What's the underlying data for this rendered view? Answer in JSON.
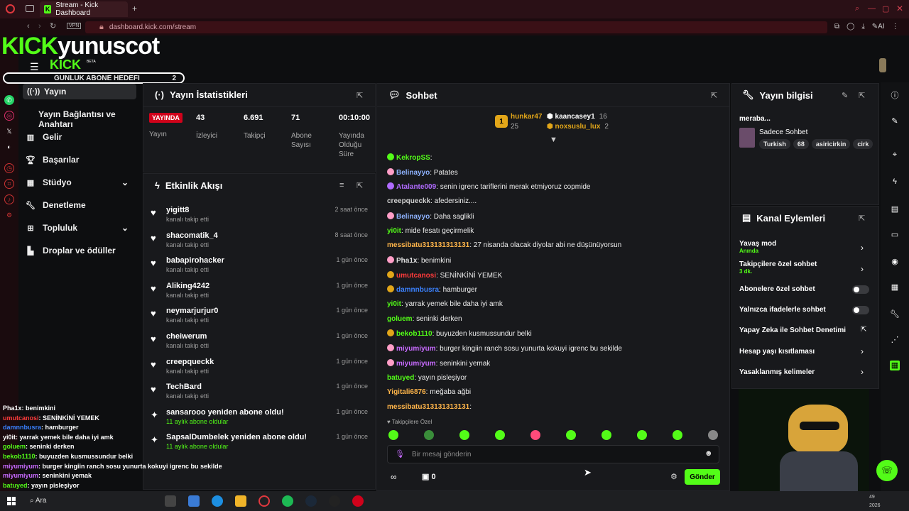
{
  "browser": {
    "tab_title": "Stream - Kick Dashboard",
    "url": "dashboard.kick.com/stream",
    "vpn": "VPN",
    "ai": "AI"
  },
  "overlay": {
    "logo_kick": "KICK",
    "channel": "yunuscot",
    "logo_sub": "KICK",
    "beta": "BETA",
    "sub_goal_label": "GUNLUK ABONE HEDEFI",
    "sub_goal_value": "2",
    "chat": [
      {
        "name": "Pha1x",
        "text": ": benimkini",
        "color": "#ffffff"
      },
      {
        "name": "umutcanosi",
        "text": ": SENİNKİNİ YEMEK",
        "color": "#ff3b3b"
      },
      {
        "name": "damnnbusra",
        "text": ": hamburger",
        "color": "#3b82ff"
      },
      {
        "name": "yi0it",
        "text": ": yarrak yemek bile daha iyi amk",
        "color": "#ffffff"
      },
      {
        "name": "goluem",
        "text": ": seninki derken",
        "color": "#53fc18"
      },
      {
        "name": "bekob1110",
        "text": ": buyuzden kusmussundur belki",
        "color": "#53fc18"
      },
      {
        "name": "miyumiyum",
        "text": ": burger kingiin ranch sosu yunurta kokuyi igrenc bu sekilde",
        "color": "#c86bff"
      },
      {
        "name": "miyumiyum",
        "text": ": seninkini yemak",
        "color": "#c86bff"
      },
      {
        "name": "batuyed",
        "text": ": yayın pisleşiyor",
        "color": "#53fc18"
      }
    ]
  },
  "nav": {
    "items": [
      {
        "label": "Yayın"
      },
      {
        "label": "Yayın Bağlantısı ve Anahtarı"
      },
      {
        "label": "Gelir"
      },
      {
        "label": "Başarılar"
      },
      {
        "label": "Stüdyo"
      },
      {
        "label": "Denetleme"
      },
      {
        "label": "Topluluk"
      },
      {
        "label": "Droplar ve ödüller"
      }
    ]
  },
  "stats": {
    "title": "Yayın İstatistikleri",
    "live": "YAYINDA",
    "live_label": "Yayın",
    "viewers": "43",
    "viewers_label": "İzleyici",
    "followers": "6.691",
    "followers_label": "Takipçi",
    "subs": "71",
    "subs_label": "Abone Sayısı",
    "uptime": "00:10:00",
    "uptime_label": "Yayında Olduğu Süre"
  },
  "activity": {
    "title": "Etkinlik Akışı",
    "events": [
      {
        "user": "yigitt8",
        "desc": "kanalı takip etti",
        "time": "2 saat önce"
      },
      {
        "user": "shacomatik_4",
        "desc": "kanalı takip etti",
        "time": "8 saat önce"
      },
      {
        "user": "babapirohacker",
        "desc": "kanalı takip etti",
        "time": "1 gün önce"
      },
      {
        "user": "Aliking4242",
        "desc": "kanalı takip etti",
        "time": "1 gün önce"
      },
      {
        "user": "neymarjurjur0",
        "desc": "kanalı takip etti",
        "time": "1 gün önce"
      },
      {
        "user": "cheiwerum",
        "desc": "kanalı takip etti",
        "time": "1 gün önce"
      },
      {
        "user": "creepqueckk",
        "desc": "kanalı takip etti",
        "time": "1 gün önce"
      },
      {
        "user": "TechBard",
        "desc": "kanalı takip etti",
        "time": "1 gün önce"
      },
      {
        "user": "sansarooo yeniden abone oldu!",
        "desc": "11 aylık abone oldular",
        "time": "1 gün önce"
      },
      {
        "user": "SapsalDumbelek yeniden abone oldu!",
        "desc": "11 aylık abone oldular",
        "time": "1 gün önce"
      }
    ]
  },
  "chat": {
    "title": "Sohbet",
    "top_gifters": [
      {
        "name": "hunkar47",
        "count": "25"
      },
      {
        "name": "kaancasey1",
        "count": "16"
      },
      {
        "name": "noxsuslu_lux",
        "count": "2"
      }
    ],
    "rank": "1",
    "messages": [
      {
        "name": "KekropSS",
        "text": ":",
        "color": "#53fc18"
      },
      {
        "name": "Belinayyo",
        "text": ": Patates",
        "color": "#8fb3ff"
      },
      {
        "name": "Atalante009",
        "text": ": senin igrenc tariflerini merak etmiyoruz copmide",
        "color": "#b06bff"
      },
      {
        "name": "creepqueckk",
        "text": ": afedersiniz....",
        "color": "#d0d0d0"
      },
      {
        "name": "Belinayyo",
        "text": ": Daha saglikli",
        "color": "#8fb3ff"
      },
      {
        "name": "yi0it",
        "text": ": mide fesatı geçirmelik",
        "color": "#53fc18"
      },
      {
        "name": "messibatu313131313131",
        "text": ": 27 nisanda olacak diyolar abi ne düşünüyorsun",
        "color": "#ffb54a"
      },
      {
        "name": "Pha1x",
        "text": ": benimkini",
        "color": "#e0e0e0"
      },
      {
        "name": "umutcanosi",
        "text": ": SENİNKİNİ YEMEK",
        "color": "#ff3b3b"
      },
      {
        "name": "damnnbusra",
        "text": ": hamburger",
        "color": "#3b82ff"
      },
      {
        "name": "yi0it",
        "text": ": yarrak yemek bile daha iyi amk",
        "color": "#53fc18"
      },
      {
        "name": "goluem",
        "text": ": seninki derken",
        "color": "#53fc18"
      },
      {
        "name": "bekob1110",
        "text": ": buyuzden kusmussundur belki",
        "color": "#53fc18"
      },
      {
        "name": "miyumiyum",
        "text": ": burger kingiin ranch sosu yunurta kokuyi igrenc bu sekilde",
        "color": "#c86bff"
      },
      {
        "name": "miyumiyum",
        "text": ": seninkini yemak",
        "color": "#c86bff"
      },
      {
        "name": "batuyed",
        "text": ": yayın pisleşiyor",
        "color": "#53fc18"
      },
      {
        "name": "Yigitali6876",
        "text": ": meğaba ağbi",
        "color": "#ffb54a"
      },
      {
        "name": "messibatu313131313131",
        "text": ":",
        "color": "#ffb54a"
      }
    ],
    "follower_mode": "Takipçilere Özel",
    "input_placeholder": "Bir mesaj gönderin",
    "points": "0",
    "send": "Gönder"
  },
  "info": {
    "title": "Yayın bilgisi",
    "stream_title": "meraba...",
    "category": "Sadece Sohbet",
    "tags": [
      "Turkish",
      "68",
      "asiricirkin",
      "cirk"
    ]
  },
  "actions": {
    "title": "Kanal Eylemleri",
    "items": [
      {
        "label": "Yavaş mod",
        "sub": "Anında"
      },
      {
        "label": "Takipçilere özel sohbet",
        "sub": "3 dk."
      },
      {
        "label": "Abonelere özel sohbet"
      },
      {
        "label": "Yalnızca ifadelerle sohbet"
      },
      {
        "label": "Yapay Zeka ile Sohbet Denetimi"
      },
      {
        "label": "Hesap yaşı kısıtlaması"
      },
      {
        "label": "Yasaklanmış kelimeler"
      }
    ]
  },
  "taskbar": {
    "search": "Ara",
    "year": "2026",
    "time_frag": "49"
  },
  "colors": {
    "accent": "#53fc18",
    "live": "#d0021b",
    "browser_chrome": "#2a1016"
  }
}
